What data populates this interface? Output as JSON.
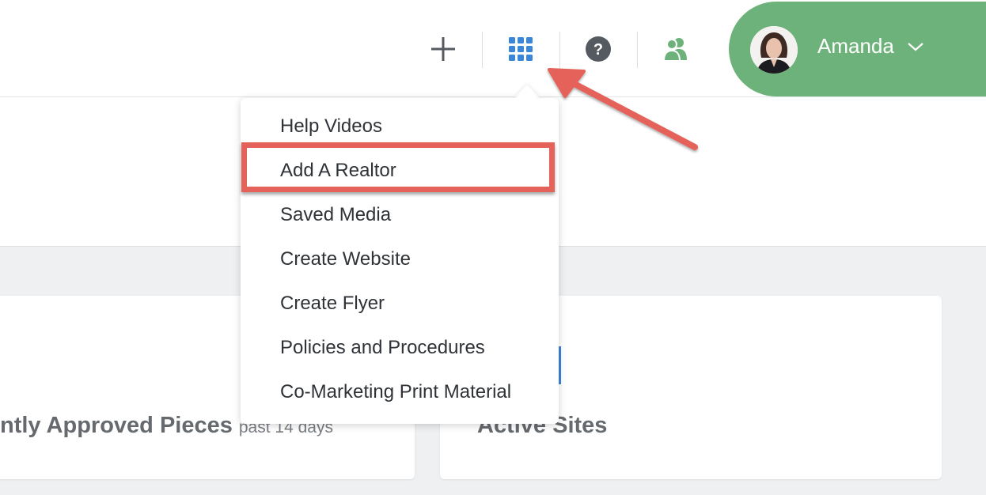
{
  "header": {
    "icons": {
      "add": "plus-icon",
      "apps": "grid-icon",
      "help": "question-icon",
      "team": "users-icon"
    },
    "colors": {
      "accent_blue": "#3a86d8",
      "green": "#6db27a",
      "icon_grey": "#555a60"
    }
  },
  "user": {
    "name": "Amanda",
    "avatar": "avatar-photo",
    "caret": "chevron-down-icon"
  },
  "menu": {
    "items": [
      "Help Videos",
      "Add A Realtor",
      "Saved Media",
      "Create Website",
      "Create Flyer",
      "Policies and Procedures",
      "Co-Marketing Print Material"
    ],
    "highlighted_index": 1,
    "highlight_color": "#e4625a"
  },
  "cards": {
    "left_title": "ntly Approved Pieces",
    "left_subtitle": "past 14 days",
    "right_title": "Active Sites"
  }
}
